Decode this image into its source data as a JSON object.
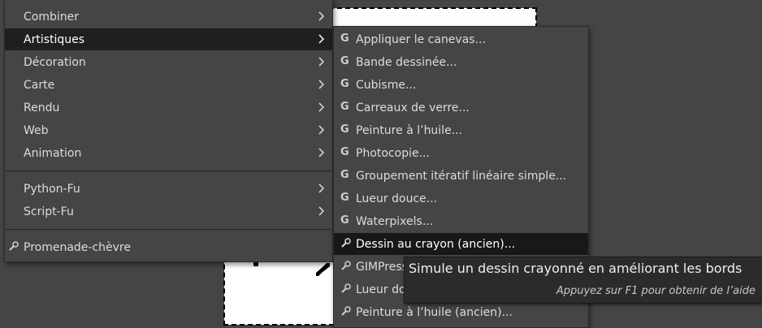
{
  "left_menu": {
    "items": [
      {
        "label": "Combiner"
      },
      {
        "label": "Artistiques"
      },
      {
        "label": "Décoration"
      },
      {
        "label": "Carte"
      },
      {
        "label": "Rendu"
      },
      {
        "label": "Web"
      },
      {
        "label": "Animation"
      },
      {
        "label": "Python-Fu"
      },
      {
        "label": "Script-Fu"
      },
      {
        "label": "Promenade-chèvre"
      }
    ]
  },
  "submenu": {
    "items": [
      {
        "label": "Appliquer le canevas...",
        "icon": "gegl-icon"
      },
      {
        "label": "Bande dessinée...",
        "icon": "gegl-icon"
      },
      {
        "label": "Cubisme...",
        "icon": "gegl-icon"
      },
      {
        "label": "Carreaux de verre...",
        "icon": "gegl-icon"
      },
      {
        "label": "Peinture à l’huile...",
        "icon": "gegl-icon"
      },
      {
        "label": "Photocopie...",
        "icon": "gegl-icon"
      },
      {
        "label": "Groupement itératif linéaire simple...",
        "icon": "gegl-icon"
      },
      {
        "label": "Lueur douce...",
        "icon": "gegl-icon"
      },
      {
        "label": "Waterpixels...",
        "icon": "gegl-icon"
      },
      {
        "label": "Dessin au crayon (ancien)...",
        "icon": "plugin-icon"
      },
      {
        "label": "GIMPress",
        "icon": "plugin-icon"
      },
      {
        "label": "Lueur dou",
        "icon": "plugin-icon"
      },
      {
        "label": "Peinture à l’huile (ancien)...",
        "icon": "plugin-icon"
      }
    ]
  },
  "tooltip": {
    "text": "Simule un dessin crayonné en améliorant les bords",
    "help": "Appuyez sur F1 pour obtenir de l’aide"
  },
  "colors": {
    "menu_bg": "#454545",
    "active_bg": "#1f1f1f",
    "tooltip_bg": "#2b2b2b"
  }
}
